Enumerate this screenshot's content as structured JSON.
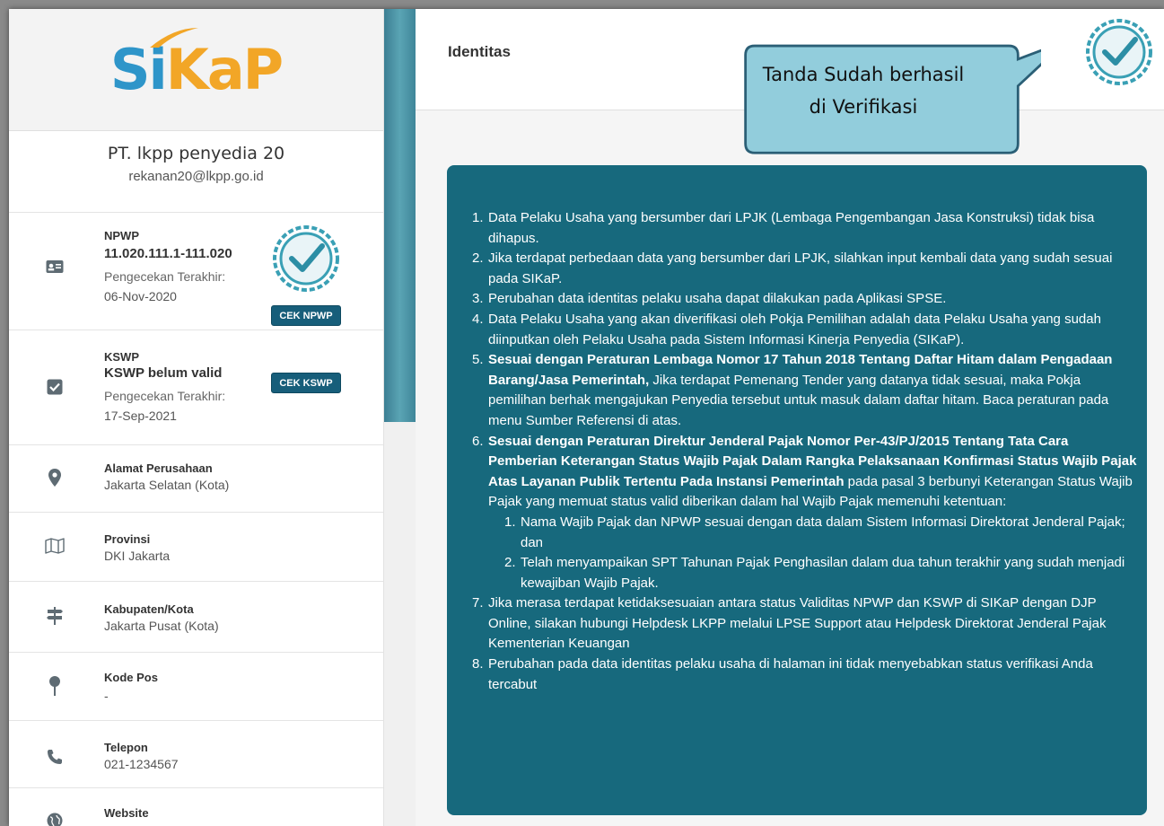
{
  "logo": {
    "text": "SiKaP"
  },
  "company": {
    "name": "PT. lkpp penyedia 20",
    "email": "rekanan20@lkpp.go.id"
  },
  "npwp": {
    "label": "NPWP",
    "value": "11.020.111.1-111.020",
    "check_label": "Pengecekan Terakhir:",
    "check_date": "06-Nov-2020",
    "button": "CEK NPWP",
    "icon": "id-card-icon"
  },
  "kswp": {
    "label": "KSWP",
    "value": "KSWP belum valid",
    "check_label": "Pengecekan Terakhir:",
    "check_date": "17-Sep-2021",
    "button": "CEK KSWP",
    "icon": "checkbox-icon"
  },
  "alamat": {
    "label": "Alamat Perusahaan",
    "value": "Jakarta Selatan (Kota)",
    "icon": "map-pin-icon"
  },
  "provinsi": {
    "label": "Provinsi",
    "value": "DKI Jakarta",
    "icon": "map-icon"
  },
  "kabupaten": {
    "label": "Kabupaten/Kota",
    "value": "Jakarta Pusat (Kota)",
    "icon": "signpost-icon"
  },
  "kodepos": {
    "label": "Kode Pos",
    "value": "-",
    "icon": "pin-icon"
  },
  "telepon": {
    "label": "Telepon",
    "value": "021-1234567",
    "icon": "phone-icon"
  },
  "website": {
    "label": "Website",
    "icon": "globe-icon"
  },
  "main": {
    "title": "Identitas"
  },
  "callout": {
    "line1": "Tanda Sudah berhasil",
    "line2": "di Verifikasi"
  },
  "colors": {
    "teal_box": "#17697d",
    "button": "#175e7a",
    "callout_fill": "#92cddc",
    "callout_border": "#2b5f76",
    "badge": "#3aa0b5"
  },
  "notes": {
    "n1": "Data Pelaku Usaha yang bersumber dari LPJK (Lembaga Pengembangan Jasa Konstruksi) tidak bisa dihapus.",
    "n2": "Jika terdapat perbedaan data yang bersumber dari LPJK, silahkan input kembali data yang sudah sesuai pada SIKaP.",
    "n3": "Perubahan data identitas pelaku usaha dapat dilakukan pada Aplikasi SPSE.",
    "n4": "Data Pelaku Usaha yang akan diverifikasi oleh Pokja Pemilihan adalah data Pelaku Usaha yang sudah diinputkan oleh Pelaku Usaha pada Sistem Informasi Kinerja Penyedia (SIKaP).",
    "n5_bold": "Sesuai dengan Peraturan Lembaga Nomor 17 Tahun 2018 Tentang Daftar Hitam dalam Pengadaan Barang/Jasa Pemerintah,",
    "n5_rest": " Jika terdapat Pemenang Tender yang datanya tidak sesuai, maka Pokja pemilihan berhak mengajukan Penyedia tersebut untuk masuk dalam daftar hitam. Baca peraturan pada menu Sumber Referensi di atas.",
    "n6_bold": "Sesuai dengan Peraturan Direktur Jenderal Pajak Nomor Per-43/PJ/2015 Tentang Tata Cara Pemberian Keterangan Status Wajib Pajak Dalam Rangka Pelaksanaan Konfirmasi Status Wajib Pajak Atas Layanan Publik Tertentu Pada Instansi Pemerintah",
    "n6_rest": " pada pasal 3 berbunyi Keterangan Status Wajib Pajak yang memuat status valid diberikan dalam hal Wajib Pajak memenuhi ketentuan:",
    "n6_1": "Nama Wajib Pajak dan NPWP sesuai dengan data dalam Sistem Informasi Direktorat Jenderal Pajak; dan",
    "n6_2": "Telah menyampaikan SPT Tahunan Pajak Penghasilan dalam dua tahun terakhir yang sudah menjadi kewajiban Wajib Pajak.",
    "n7": "Jika merasa terdapat ketidaksesuaian antara status Validitas NPWP dan KSWP di SIKaP dengan DJP Online, silakan hubungi Helpdesk LKPP melalui LPSE Support atau Helpdesk Direktorat Jenderal Pajak Kementerian Keuangan",
    "n8": "Perubahan pada data identitas pelaku usaha di halaman ini tidak menyebabkan status verifikasi Anda tercabut"
  }
}
